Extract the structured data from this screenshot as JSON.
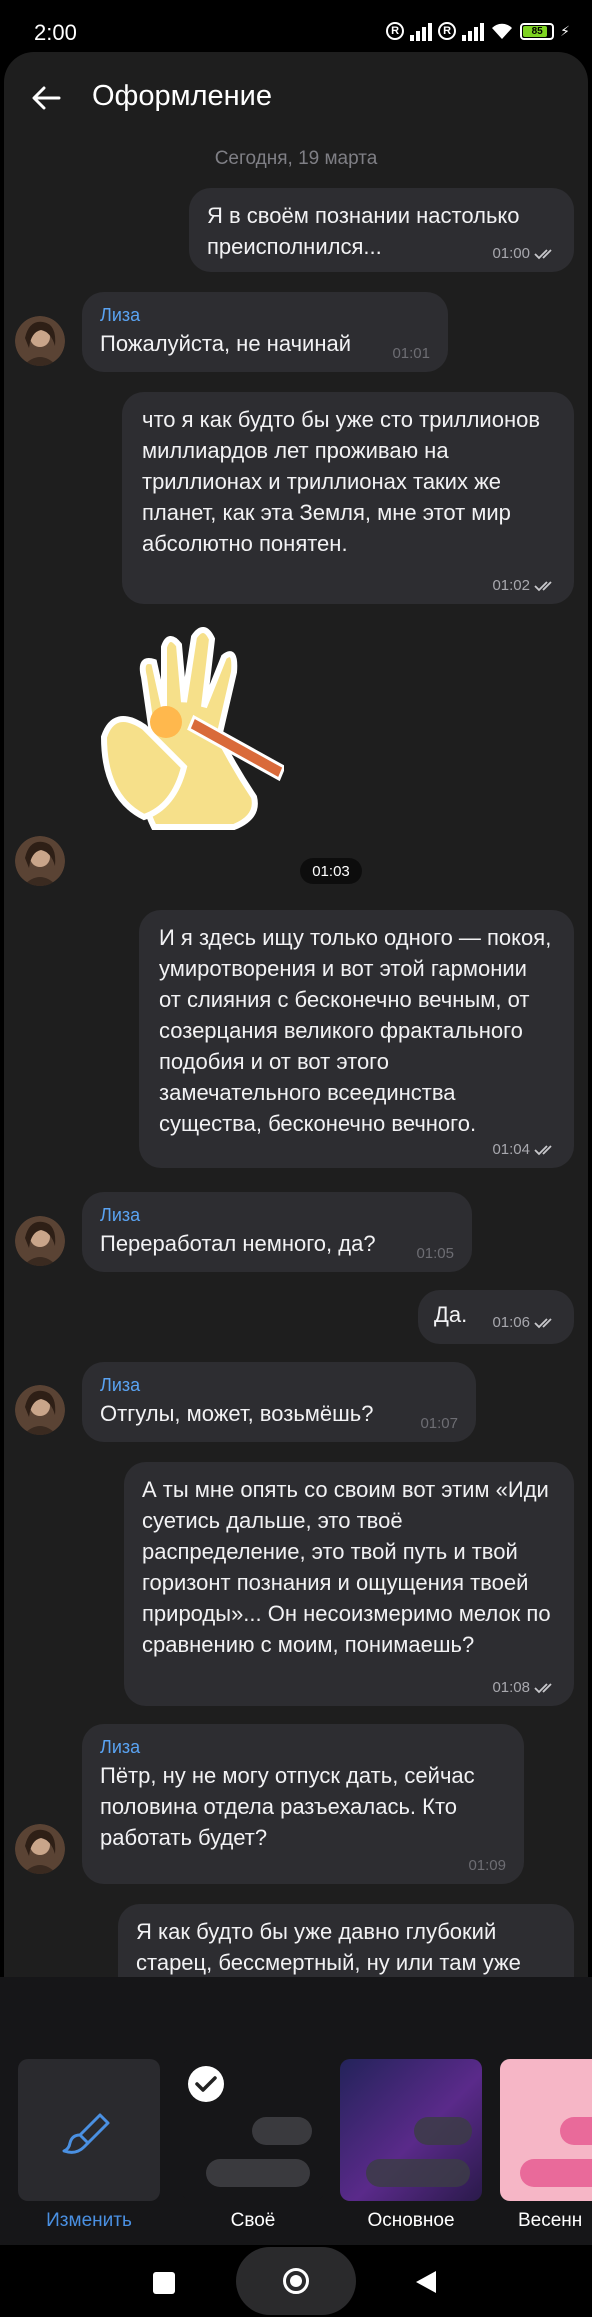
{
  "status_bar": {
    "time": "2:00",
    "battery": "85"
  },
  "header": {
    "title": "Оформление"
  },
  "chat": {
    "date_divider": "Сегодня, 19 марта",
    "messages": [
      {
        "direction": "out",
        "text": "Я в своём познании настолько преисполнился...",
        "time": "01:00"
      },
      {
        "direction": "in",
        "sender": "Лиза",
        "text": "Пожалуйста, не начинай",
        "time": "01:01"
      },
      {
        "direction": "out",
        "text": "что я как будто бы уже сто триллионов миллиардов лет проживаю на триллионах и триллионах таких же планет, как эта Земля, мне этот мир абсолютно понятен.",
        "time": "01:02"
      },
      {
        "direction": "in",
        "type": "sticker",
        "time": "01:03"
      },
      {
        "direction": "out",
        "text": "И я здесь ищу только одного — покоя, умиротворения и вот этой гармонии от слияния с бесконечно вечным, от созерцания великого фрактального подобия и от вот этого замечательного всеединства существа, бесконечно вечного.",
        "time": "01:04"
      },
      {
        "direction": "in",
        "sender": "Лиза",
        "text": "Переработал немного, да?",
        "time": "01:05"
      },
      {
        "direction": "out",
        "text": "Да.",
        "time": "01:06"
      },
      {
        "direction": "in",
        "sender": "Лиза",
        "text": "Отгулы, может, возьмёшь?",
        "time": "01:07"
      },
      {
        "direction": "out",
        "text": "А ты мне опять со своим вот этим «Иди суетись дальше, это твоё распределение, это твой путь и твой горизонт познания и ощущения твоей природы»... Он несоизмеримо мелок по сравнению с моим, понимаешь?",
        "time": "01:08"
      },
      {
        "direction": "in",
        "sender": "Лиза",
        "text": "Пётр, ну не могу отпуск дать, сейчас половина отдела разъехалась. Кто работать будет?",
        "time": "01:09"
      },
      {
        "direction": "out",
        "text": "Я как будто бы уже давно глубокий старец, бессмертный, ну или там уже почти бессмертный, который на этой планете от её самого зарождения. Я"
      }
    ]
  },
  "themes": {
    "selected": "Своё",
    "items": [
      {
        "label": "Изменить",
        "icon": "brush-icon"
      },
      {
        "label": "Своё"
      },
      {
        "label": "Основное"
      },
      {
        "label": "Весенн"
      }
    ]
  },
  "colors": {
    "accent": "#4a90e2",
    "bubble": "#2d2d31",
    "background": "#1e1e1e",
    "sender_name": "#5aa3f2"
  }
}
